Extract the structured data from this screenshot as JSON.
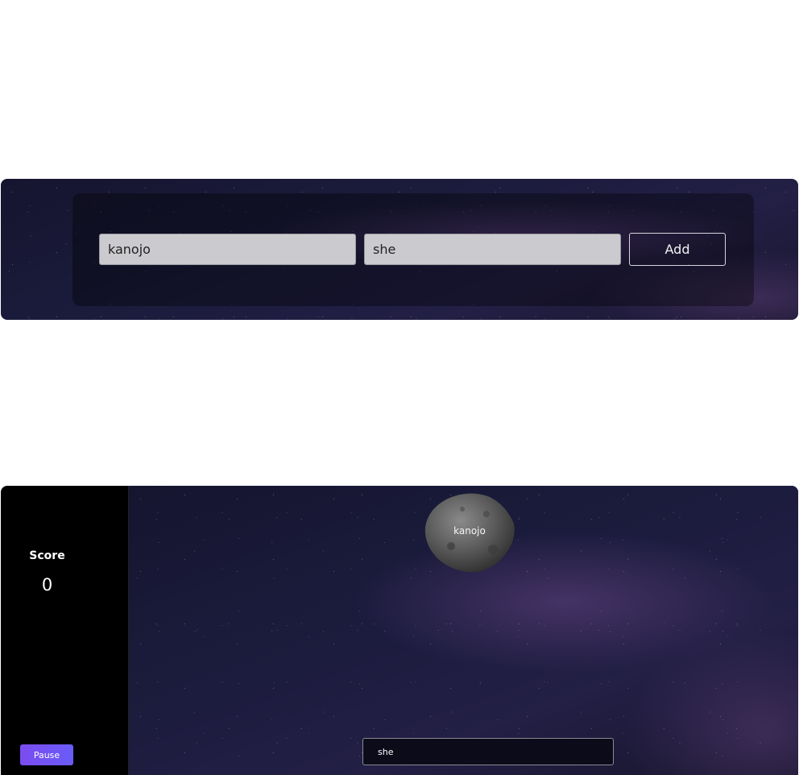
{
  "entry_form": {
    "word_value": "kanojo",
    "translation_value": "she",
    "add_label": "Add"
  },
  "game": {
    "score_label": "Score",
    "score_value": "0",
    "pause_label": "Pause",
    "falling_word": "kanojo",
    "answer_value": "she"
  },
  "colors": {
    "pause_button": "#7b4cf0",
    "sidebar": "#000000",
    "space": "#1c1c3e"
  }
}
